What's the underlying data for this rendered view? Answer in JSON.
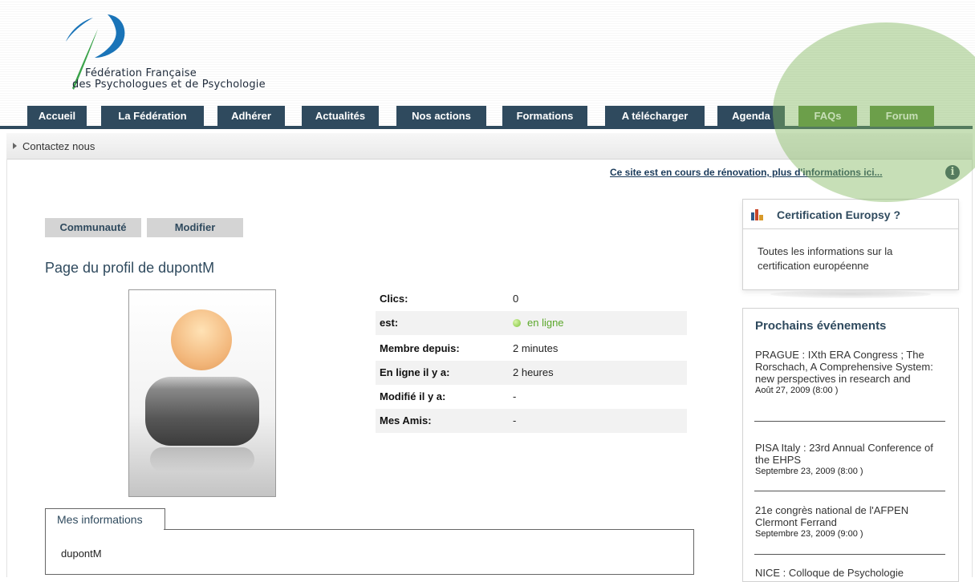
{
  "logo": {
    "line1": "Fédération Française",
    "line2": "des Psychologues et de Psychologie"
  },
  "nav": {
    "items": [
      "Accueil",
      "La Fédération",
      "Adhérer",
      "Actualités",
      "Nos actions",
      "Formations",
      "A télécharger",
      "Agenda",
      "FAQs",
      "Forum"
    ]
  },
  "subnav": {
    "link": "Contactez nous"
  },
  "notice": {
    "text": "Ce site est en cours de rénovation, plus d'informations ici...",
    "icon": "info-icon"
  },
  "profile": {
    "tabs": [
      "Communauté",
      "Modifier"
    ],
    "title": "Page du profil de dupontM",
    "fields": [
      {
        "label": "Clics:",
        "value": "0"
      },
      {
        "label": "est:",
        "value": "en ligne"
      },
      {
        "label": "Membre depuis:",
        "value": "2 minutes"
      },
      {
        "label": "En ligne il y a:",
        "value": "2 heures"
      },
      {
        "label": "Modifié il y a:",
        "value": "-"
      },
      {
        "label": "Mes Amis:",
        "value": "-"
      }
    ],
    "mes_informations": {
      "tab_label": "Mes informations",
      "value": "dupontM"
    }
  },
  "sidebar": {
    "certification": {
      "title": "Certification Europsy ?",
      "text": "Toutes les informations sur la certification européenne"
    },
    "events": {
      "title": "Prochains événements",
      "items": [
        {
          "title": "PRAGUE : IXth ERA Congress ; The Rorschach, A Comprehensive System: new perspectives in research and",
          "date": "Août 27, 2009 (8:00 )"
        },
        {
          "title": "PISA Italy : 23rd Annual Conference of the EHPS",
          "date": "Septembre 23, 2009 (8:00 )"
        },
        {
          "title": "21e congrès national de l'AFPEN Clermont Ferrand",
          "date": "Septembre 23, 2009 (9:00 )"
        },
        {
          "title": "NICE : Colloque de Psychologie",
          "date": ""
        }
      ]
    }
  },
  "colors": {
    "nav_blue": "#2f4a5e",
    "nav_green": "#5a8a3a",
    "online_green": "#5aa72a"
  }
}
